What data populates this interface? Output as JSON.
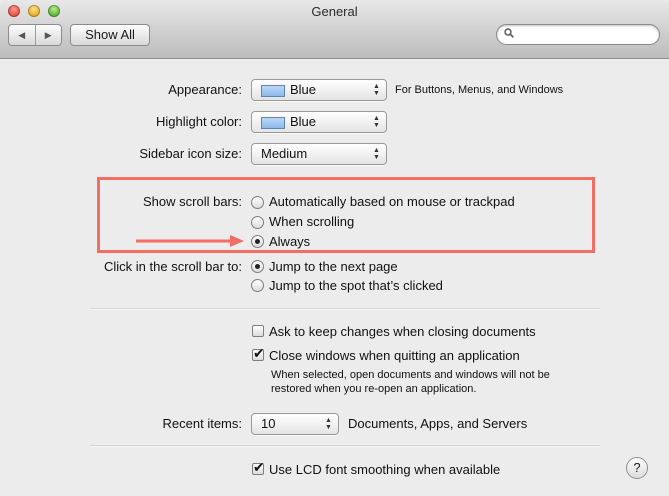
{
  "window": {
    "title": "General"
  },
  "toolbar": {
    "back_label": "◀",
    "forward_label": "▶",
    "show_all_label": "Show All",
    "search_placeholder": "",
    "search_value": ""
  },
  "appearance": {
    "label": "Appearance:",
    "value": "Blue",
    "note": "For Buttons, Menus, and Windows"
  },
  "highlight_color": {
    "label": "Highlight color:",
    "value": "Blue"
  },
  "sidebar_icon_size": {
    "label": "Sidebar icon size:",
    "value": "Medium"
  },
  "show_scroll_bars": {
    "label": "Show scroll bars:",
    "options": [
      {
        "label": "Automatically based on mouse or trackpad",
        "selected": false
      },
      {
        "label": "When scrolling",
        "selected": false
      },
      {
        "label": "Always",
        "selected": true
      }
    ]
  },
  "click_scroll_bar": {
    "label": "Click in the scroll bar to:",
    "options": [
      {
        "label": "Jump to the next page",
        "selected": true
      },
      {
        "label": "Jump to the spot that’s clicked",
        "selected": false
      }
    ]
  },
  "documents": {
    "ask_keep_changes": {
      "label": "Ask to keep changes when closing documents",
      "checked": false
    },
    "close_windows": {
      "label": "Close windows when quitting an application",
      "checked": true
    },
    "close_windows_note_line1": "When selected, open documents and windows will not be",
    "close_windows_note_line2": "restored when you re-open an application."
  },
  "recent_items": {
    "label": "Recent items:",
    "value": "10",
    "suffix": "Documents, Apps, and Servers"
  },
  "lcd_smoothing": {
    "label": "Use LCD font smoothing when available",
    "checked": true
  },
  "help": {
    "label": "?"
  },
  "colors": {
    "highlight_box": "#f26e62",
    "arrow": "#f26e62",
    "swatch_blue": "#a9c8f0"
  }
}
